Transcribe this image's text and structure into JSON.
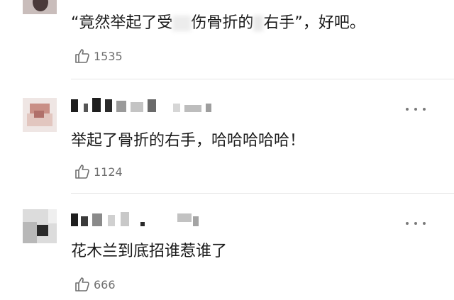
{
  "comments": [
    {
      "text_parts": [
        "“竟然举起了受",
        "伤骨折的",
        "右手”，好吧。"
      ],
      "likes": "1535"
    },
    {
      "text": "举起了骨折的右手，哈哈哈哈哈！",
      "likes": "1124"
    },
    {
      "text": "花木兰到底招谁惹谁了",
      "likes": "666"
    }
  ],
  "icons": {
    "like": "thumbs-up-icon",
    "more": "more-dots-icon"
  },
  "colors": {
    "text": "#1a1a1a",
    "meta": "#6e6e6e",
    "divider": "#e6e6e6"
  }
}
